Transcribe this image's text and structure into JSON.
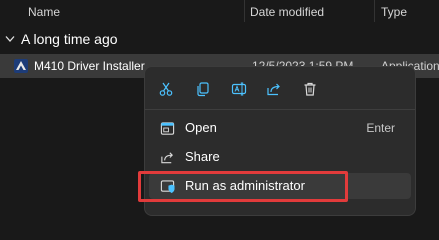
{
  "columns": {
    "name": "Name",
    "date_modified": "Date modified",
    "type": "Type"
  },
  "group": {
    "label": "A long time ago"
  },
  "file": {
    "name": "M410 Driver Installer",
    "date": "12/5/2023 1:59 PM",
    "type": "Application"
  },
  "quick_actions": [
    {
      "icon": "cut-icon"
    },
    {
      "icon": "copy-icon"
    },
    {
      "icon": "rename-icon"
    },
    {
      "icon": "share-icon"
    },
    {
      "icon": "delete-icon"
    }
  ],
  "menu": {
    "open_label": "Open",
    "open_shortcut": "Enter",
    "share_label": "Share",
    "run_admin_label": "Run as administrator"
  },
  "colors": {
    "accent": "#4cc2ff",
    "highlight": "#e23b3b",
    "menu_bg": "#2c2c2c",
    "bg": "#191919"
  }
}
